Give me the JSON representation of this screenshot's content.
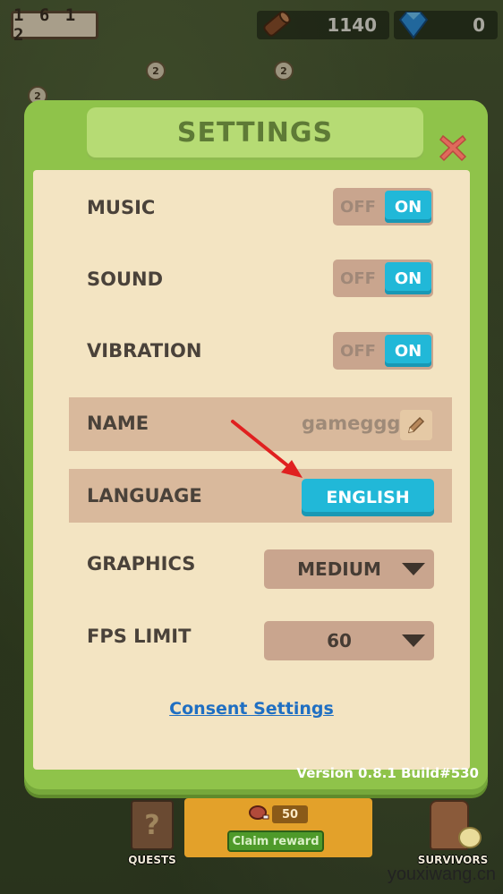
{
  "hud": {
    "timer": "1 6 1 2",
    "wood_count": "1140",
    "gem_count": "0",
    "badges": [
      "2",
      "2",
      "2"
    ]
  },
  "settings": {
    "title": "SETTINGS",
    "music": {
      "label": "MUSIC",
      "off": "OFF",
      "on": "ON"
    },
    "sound": {
      "label": "SOUND",
      "off": "OFF",
      "on": "ON"
    },
    "vibration": {
      "label": "VIBRATION",
      "off": "OFF",
      "on": "ON"
    },
    "name": {
      "label": "NAME",
      "value": "gameggg"
    },
    "language": {
      "label": "LANGUAGE",
      "value": "ENGLISH"
    },
    "graphics": {
      "label": "GRAPHICS",
      "value": "MEDIUM"
    },
    "fps": {
      "label": "FPS LIMIT",
      "value": "60"
    },
    "consent_link": "Consent Settings",
    "version": "Version 0.8.1 Build#530"
  },
  "bottom": {
    "quests_label": "QUESTS",
    "reward_count": "50",
    "claim_label": "Claim reward",
    "survivors_label": "SURVIVORS"
  },
  "watermark": "youxiwang.cn",
  "colors": {
    "panel_green": "#8fc34a",
    "panel_cream": "#f3e4c2",
    "accent_cyan": "#21b8d8",
    "toggle_bg": "#c9a58e",
    "link_blue": "#1f6fc2",
    "close_red": "#e06a5c",
    "annotation_red": "#e02020"
  },
  "icons": [
    "wood-log-icon",
    "blue-gem-icon",
    "close-x-icon",
    "pencil-edit-icon",
    "dropdown-triangle-icon",
    "meat-icon",
    "question-book-icon"
  ]
}
